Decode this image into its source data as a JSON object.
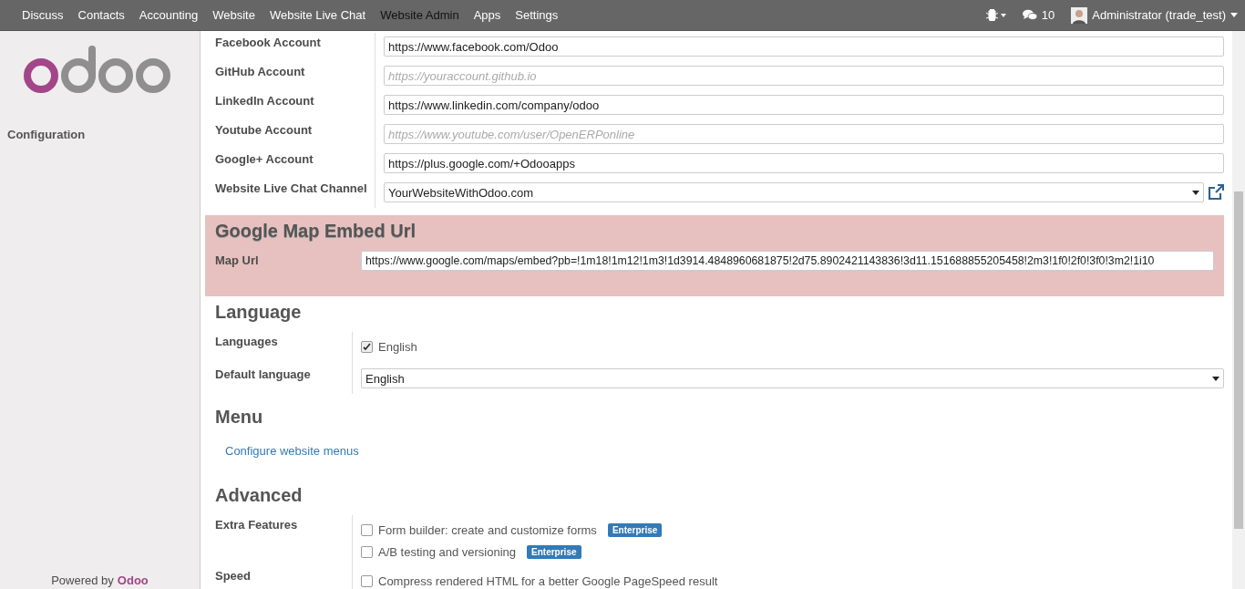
{
  "navbar": {
    "apps": [
      {
        "label": "Discuss",
        "selected": false
      },
      {
        "label": "Contacts",
        "selected": false
      },
      {
        "label": "Accounting",
        "selected": false
      },
      {
        "label": "Website",
        "selected": false
      },
      {
        "label": "Website Live Chat",
        "selected": false
      },
      {
        "label": "Website Admin",
        "selected": true
      },
      {
        "label": "Apps",
        "selected": false
      },
      {
        "label": "Settings",
        "selected": false
      }
    ],
    "messages_count": "10",
    "user": "Administrator (trade_test)"
  },
  "sidebar": {
    "section": "Configuration",
    "powered_by": "Powered by",
    "brand": "Odoo"
  },
  "social": [
    {
      "label": "Facebook Account",
      "kind": "text",
      "value": "https://www.facebook.com/Odoo"
    },
    {
      "label": "GitHub Account",
      "kind": "text",
      "placeholder": "https://youraccount.github.io"
    },
    {
      "label": "LinkedIn Account",
      "kind": "text",
      "value": "https://www.linkedin.com/company/odoo"
    },
    {
      "label": "Youtube Account",
      "kind": "text",
      "placeholder": "https://www.youtube.com/user/OpenERPonline"
    },
    {
      "label": "Google+ Account",
      "kind": "text",
      "value": "https://plus.google.com/+Odooapps"
    },
    {
      "label": "Website Live Chat Channel",
      "kind": "select",
      "value": "YourWebsiteWithOdoo.com"
    }
  ],
  "map_section": {
    "title": "Google Map Embed Url",
    "label": "Map Url",
    "value": "https://www.google.com/maps/embed?pb=!1m18!1m12!1m3!1d3914.4848960681875!2d75.8902421143836!3d11.151688855205458!2m3!1f0!2f0!3f0!3m2!1i10"
  },
  "language": {
    "title": "Language",
    "fields": [
      {
        "label": "Languages",
        "kind": "checkboxes",
        "options": [
          {
            "label": "English",
            "checked": true
          }
        ]
      },
      {
        "label": "Default language",
        "kind": "select",
        "value": "English"
      }
    ]
  },
  "menu": {
    "title": "Menu",
    "link": "Configure website menus"
  },
  "advanced": {
    "title": "Advanced",
    "fields": [
      {
        "label": "Extra Features",
        "kind": "checkboxes",
        "options": [
          {
            "label": "Form builder: create and customize forms",
            "checked": false,
            "badge": "Enterprise"
          },
          {
            "label": "A/B testing and versioning",
            "checked": false,
            "badge": "Enterprise"
          }
        ]
      },
      {
        "label": "Speed",
        "kind": "checkboxes",
        "options": [
          {
            "label": "Compress rendered HTML for a better Google PageSpeed result",
            "checked": false
          }
        ]
      }
    ]
  }
}
